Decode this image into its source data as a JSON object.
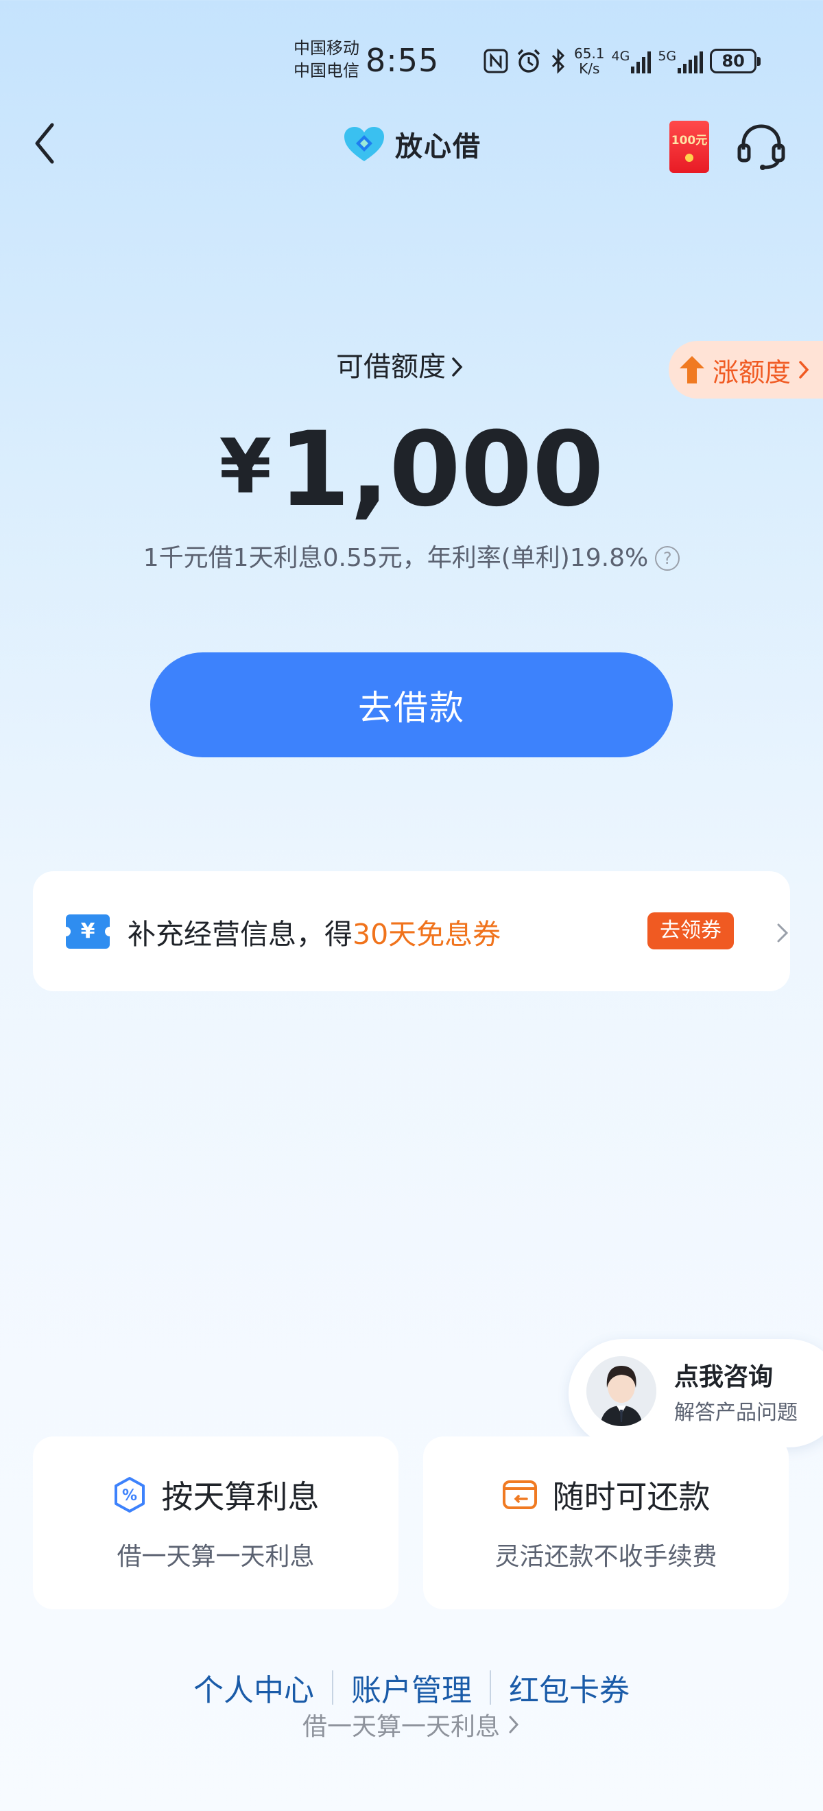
{
  "status_bar": {
    "carrier_1": "中国移动",
    "carrier_2": "中国电信",
    "time": "8:55",
    "speed_value": "65.1",
    "speed_unit": "K/s",
    "net_1": "4G",
    "net_2": "5G",
    "battery": "80"
  },
  "header": {
    "brand": "放心借",
    "redpacket_amount": "100元"
  },
  "quota": {
    "label": "可借额度",
    "currency": "¥",
    "amount": "1,000",
    "rate_note": "1千元借1天利息0.55元，年利率(单利)19.8%",
    "help_icon": "?",
    "raise_label": "涨额度"
  },
  "borrow_button": "去借款",
  "promo": {
    "icon_glyph": "¥",
    "text_prefix": "补充经营信息，得",
    "text_highlight": "30天免息券",
    "tag": "去领券"
  },
  "consult": {
    "title": "点我咨询",
    "subtitle": "解答产品问题"
  },
  "features": [
    {
      "title": "按天算利息",
      "subtitle": "借一天算一天利息",
      "icon": "percent-shield-icon"
    },
    {
      "title": "随时可还款",
      "subtitle": "灵活还款不收手续费",
      "icon": "wallet-icon"
    }
  ],
  "footer": {
    "links": [
      "个人中心",
      "账户管理",
      "红包卡券"
    ],
    "subtext": "借一天算一天利息"
  },
  "colors": {
    "primary": "#3d82fc",
    "accent_orange": "#f05a22",
    "highlight_orange": "#f0731c",
    "link_blue": "#1a5ba8"
  }
}
